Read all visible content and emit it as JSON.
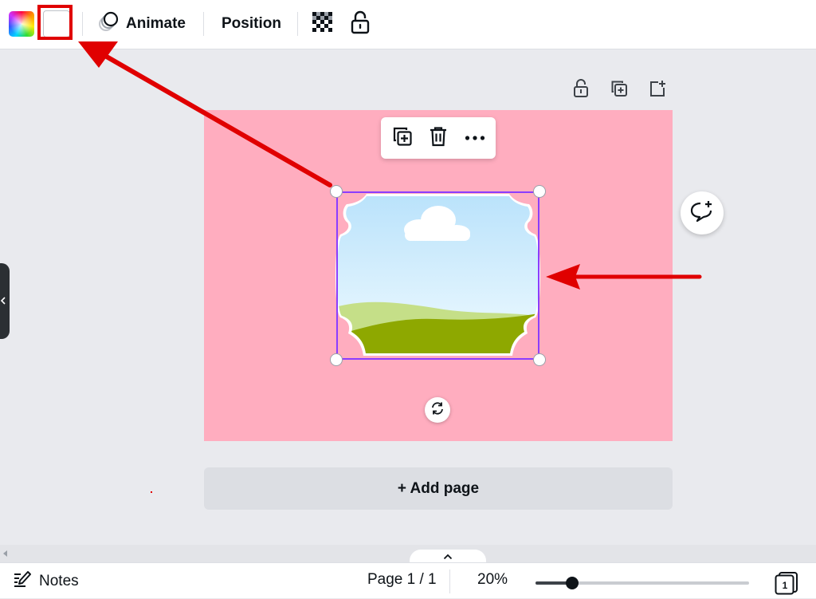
{
  "toolbar": {
    "animate_label": "Animate",
    "position_label": "Position",
    "icons": [
      "color-picker-icon",
      "animate-icon",
      "transparency-icon",
      "lock-icon"
    ]
  },
  "page_actions": {
    "icons": [
      "lock-page-icon",
      "duplicate-page-icon",
      "add-page-icon"
    ]
  },
  "context_menu": {
    "icons": [
      "duplicate-icon",
      "trash-icon",
      "more-options-icon"
    ]
  },
  "canvas": {
    "background_color": "#ffadbf",
    "selection_color": "#8b3dff",
    "add_page_label": "+ Add page"
  },
  "footer": {
    "notes_label": "Notes",
    "page_indicator": "Page 1 / 1",
    "zoom_label": "20%",
    "zoom_percent": 20,
    "page_count_badge": "1"
  },
  "annotations": {
    "highlight_color": "#e00000"
  }
}
